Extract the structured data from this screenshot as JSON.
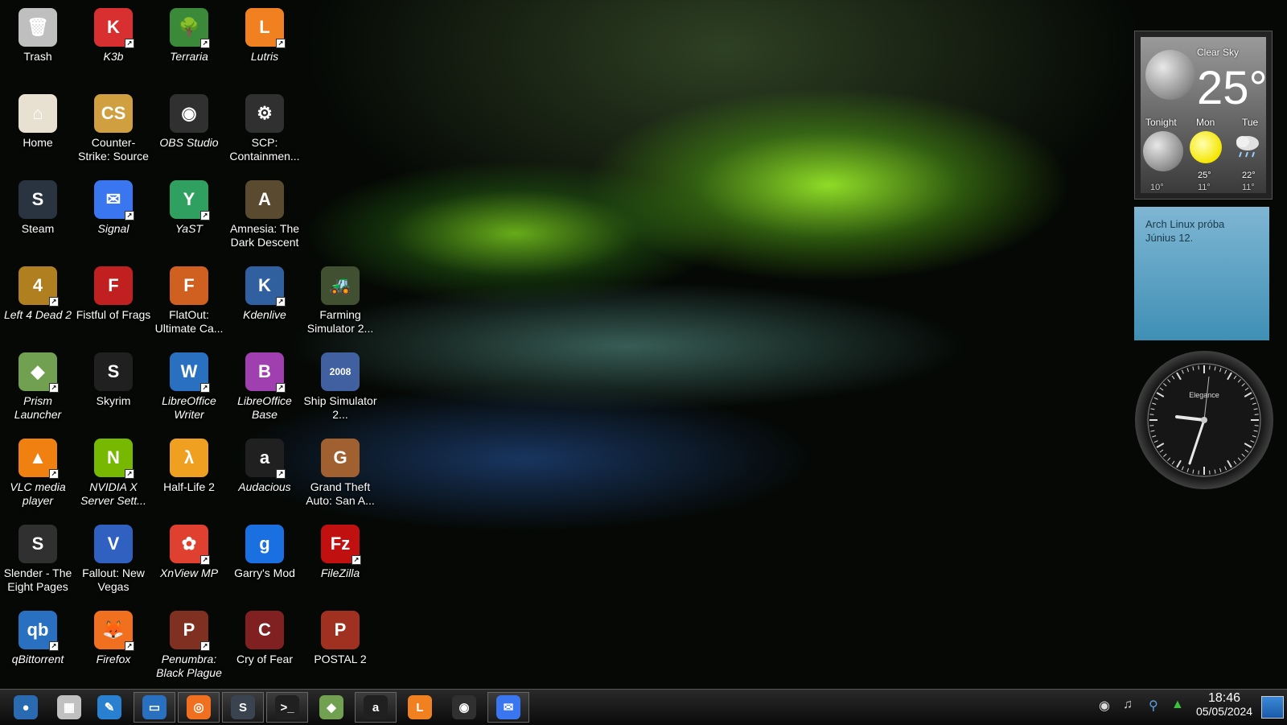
{
  "desktop_icons": [
    {
      "label": "Trash",
      "color": "#bfbfbf",
      "glyph": "🗑",
      "italic": false,
      "link": false,
      "col": 0,
      "row": 0
    },
    {
      "label": "K3b",
      "color": "#d83030",
      "glyph": "K",
      "italic": true,
      "link": true,
      "col": 1,
      "row": 0
    },
    {
      "label": "Terraria",
      "color": "#3a8a3a",
      "glyph": "🌳",
      "italic": true,
      "link": true,
      "col": 2,
      "row": 0
    },
    {
      "label": "Lutris",
      "color": "#f08020",
      "glyph": "L",
      "italic": true,
      "link": true,
      "col": 3,
      "row": 0
    },
    {
      "label": "Home",
      "color": "#e8e0d0",
      "glyph": "⌂",
      "italic": false,
      "link": false,
      "col": 0,
      "row": 1
    },
    {
      "label": "Counter-Strike: Source",
      "color": "#d0a040",
      "glyph": "CS",
      "italic": false,
      "link": false,
      "col": 1,
      "row": 1
    },
    {
      "label": "OBS Studio",
      "color": "#303030",
      "glyph": "◉",
      "italic": true,
      "link": false,
      "col": 2,
      "row": 1
    },
    {
      "label": "SCP: Containmen...",
      "color": "#303030",
      "glyph": "⚙",
      "italic": false,
      "link": false,
      "col": 3,
      "row": 1
    },
    {
      "label": "Steam",
      "color": "#2a3440",
      "glyph": "S",
      "italic": false,
      "link": false,
      "col": 0,
      "row": 2
    },
    {
      "label": "Signal",
      "color": "#3a76f0",
      "glyph": "✉",
      "italic": true,
      "link": true,
      "col": 1,
      "row": 2
    },
    {
      "label": "YaST",
      "color": "#30a060",
      "glyph": "Y",
      "italic": true,
      "link": true,
      "col": 2,
      "row": 2
    },
    {
      "label": "Amnesia: The Dark Descent",
      "color": "#5a4a30",
      "glyph": "A",
      "italic": false,
      "link": false,
      "col": 3,
      "row": 2
    },
    {
      "label": "Left 4 Dead 2",
      "color": "#b08020",
      "glyph": "4",
      "italic": true,
      "link": true,
      "col": 0,
      "row": 3
    },
    {
      "label": "Fistful of Frags",
      "color": "#c02020",
      "glyph": "F",
      "italic": false,
      "link": false,
      "col": 1,
      "row": 3
    },
    {
      "label": "FlatOut: Ultimate Ca...",
      "color": "#d06020",
      "glyph": "F",
      "italic": false,
      "link": false,
      "col": 2,
      "row": 3
    },
    {
      "label": "Kdenlive",
      "color": "#3060a0",
      "glyph": "K",
      "italic": true,
      "link": true,
      "col": 3,
      "row": 3
    },
    {
      "label": "Farming Simulator 2...",
      "color": "#405030",
      "glyph": "🚜",
      "italic": false,
      "link": false,
      "col": 4,
      "row": 3
    },
    {
      "label": "Prism Launcher",
      "color": "#70a050",
      "glyph": "◆",
      "italic": true,
      "link": true,
      "col": 0,
      "row": 4
    },
    {
      "label": "Skyrim",
      "color": "#202020",
      "glyph": "S",
      "italic": false,
      "link": false,
      "col": 1,
      "row": 4
    },
    {
      "label": "LibreOffice Writer",
      "color": "#2a70c0",
      "glyph": "W",
      "italic": true,
      "link": true,
      "col": 2,
      "row": 4
    },
    {
      "label": "LibreOffice Base",
      "color": "#a040b0",
      "glyph": "B",
      "italic": true,
      "link": true,
      "col": 3,
      "row": 4
    },
    {
      "label": "Ship Simulator 2...",
      "color": "#4060a0",
      "glyph": "2008",
      "italic": false,
      "link": false,
      "col": 4,
      "row": 4
    },
    {
      "label": "VLC media player",
      "color": "#f08010",
      "glyph": "▲",
      "italic": true,
      "link": true,
      "col": 0,
      "row": 5
    },
    {
      "label": "NVIDIA X Server Sett...",
      "color": "#76b900",
      "glyph": "N",
      "italic": true,
      "link": true,
      "col": 1,
      "row": 5
    },
    {
      "label": "Half-Life 2",
      "color": "#f0a020",
      "glyph": "λ",
      "italic": false,
      "link": false,
      "col": 2,
      "row": 5
    },
    {
      "label": "Audacious",
      "color": "#202020",
      "glyph": "a",
      "italic": true,
      "link": true,
      "col": 3,
      "row": 5
    },
    {
      "label": "Grand Theft Auto: San A...",
      "color": "#a06030",
      "glyph": "G",
      "italic": false,
      "link": false,
      "col": 4,
      "row": 5
    },
    {
      "label": "Slender - The Eight Pages",
      "color": "#303030",
      "glyph": "S",
      "italic": false,
      "link": false,
      "col": 0,
      "row": 6
    },
    {
      "label": "Fallout: New Vegas",
      "color": "#3060c0",
      "glyph": "V",
      "italic": false,
      "link": false,
      "col": 1,
      "row": 6
    },
    {
      "label": "XnView MP",
      "color": "#e04030",
      "glyph": "✿",
      "italic": true,
      "link": true,
      "col": 2,
      "row": 6
    },
    {
      "label": "Garry's Mod",
      "color": "#1a70e0",
      "glyph": "g",
      "italic": false,
      "link": false,
      "col": 3,
      "row": 6
    },
    {
      "label": "FileZilla",
      "color": "#c01010",
      "glyph": "Fz",
      "italic": true,
      "link": true,
      "col": 4,
      "row": 6
    },
    {
      "label": "qBittorrent",
      "color": "#2a70c0",
      "glyph": "qb",
      "italic": true,
      "link": true,
      "col": 0,
      "row": 7
    },
    {
      "label": "Firefox",
      "color": "#f07020",
      "glyph": "🦊",
      "italic": true,
      "link": true,
      "col": 1,
      "row": 7
    },
    {
      "label": "Penumbra: Black Plague",
      "color": "#803020",
      "glyph": "P",
      "italic": true,
      "link": true,
      "col": 2,
      "row": 7
    },
    {
      "label": "Cry of Fear",
      "color": "#802020",
      "glyph": "C",
      "italic": false,
      "link": false,
      "col": 3,
      "row": 7
    },
    {
      "label": "POSTAL 2",
      "color": "#a03020",
      "glyph": "P",
      "italic": false,
      "link": false,
      "col": 4,
      "row": 7
    }
  ],
  "weather": {
    "condition": "Clear Sky",
    "temperature": "25°",
    "forecast": [
      {
        "day": "Tonight",
        "high": "",
        "low": "10°",
        "icon": "moon-icon"
      },
      {
        "day": "Mon",
        "high": "25°",
        "low": "11°",
        "icon": "sun-icon"
      },
      {
        "day": "Tue",
        "high": "22°",
        "low": "11°",
        "icon": "rain-cloud-icon"
      }
    ]
  },
  "note": {
    "line1": "Arch Linux próba",
    "line2": "Június 12."
  },
  "clock": {
    "brand": "Elegance"
  },
  "taskbar": {
    "apps": [
      {
        "name": "application-launcher",
        "color": "#2a6ab0",
        "glyph": "●",
        "active": false
      },
      {
        "name": "app-grid",
        "color": "#c0c0c0",
        "glyph": "▦",
        "active": false
      },
      {
        "name": "notes-app",
        "color": "#2a80d0",
        "glyph": "✎",
        "active": false
      },
      {
        "name": "file-manager",
        "color": "#2a70c0",
        "glyph": "▭",
        "active": true
      },
      {
        "name": "firefox",
        "color": "#f07020",
        "glyph": "◎",
        "active": true
      },
      {
        "name": "steam",
        "color": "#3a4450",
        "glyph": "S",
        "active": true
      },
      {
        "name": "terminal",
        "color": "#202020",
        "glyph": ">_",
        "active": true
      },
      {
        "name": "prism-launcher",
        "color": "#70a050",
        "glyph": "◆",
        "active": false
      },
      {
        "name": "audacious",
        "color": "#202020",
        "glyph": "a",
        "active": true
      },
      {
        "name": "lutris",
        "color": "#f08020",
        "glyph": "L",
        "active": false
      },
      {
        "name": "obs-studio",
        "color": "#303030",
        "glyph": "◉",
        "active": false
      },
      {
        "name": "signal",
        "color": "#3a76f0",
        "glyph": "✉",
        "active": true
      }
    ],
    "time": "18:46",
    "date": "05/05/2024"
  }
}
